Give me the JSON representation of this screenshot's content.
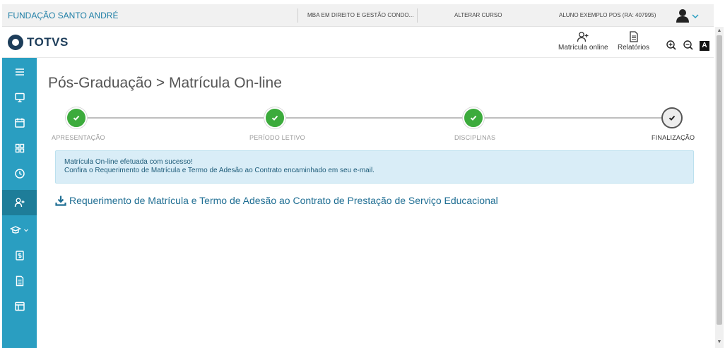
{
  "topbar": {
    "institution": "FUNDAÇÃO SANTO ANDRÉ",
    "course": "MBA EM DIREITO E GESTÃO CONDO...",
    "change_course": "ALTERAR CURSO",
    "student": "ALUNO EXEMPLO POS (RA: 407995)"
  },
  "header": {
    "logo_text": "TOTVS",
    "enroll_label": "Matrícula online",
    "reports_label": "Relatórios",
    "contrast_label": "A"
  },
  "sidebar": {
    "items": [
      {
        "icon": "menu-icon"
      },
      {
        "icon": "monitor-icon"
      },
      {
        "icon": "calendar-icon"
      },
      {
        "icon": "grid-icon"
      },
      {
        "icon": "clock-icon"
      },
      {
        "icon": "add-user-icon",
        "active": true
      },
      {
        "icon": "graduation-cap-icon"
      },
      {
        "icon": "money-icon"
      },
      {
        "icon": "document-icon"
      },
      {
        "icon": "layout-icon"
      }
    ]
  },
  "page": {
    "title": "Pós-Graduação > Matrícula On-line"
  },
  "stepper": {
    "steps": [
      {
        "label": "APRESENTAÇÃO",
        "state": "done"
      },
      {
        "label": "PERÍODO LETIVO",
        "state": "done"
      },
      {
        "label": "DISCIPLINAS",
        "state": "done"
      },
      {
        "label": "FINALIZAÇÃO",
        "state": "current"
      }
    ]
  },
  "alert": {
    "line1": "Matrícula On-line efetuada com sucesso!",
    "line2": "Confira o Requerimento de Matrícula e Termo de Adesão ao Contrato encaminhado em seu e-mail."
  },
  "download": {
    "label": "Requerimento de Matrícula e Termo de Adesão ao Contrato de Prestação de Serviço Educacional"
  },
  "colors": {
    "accent": "#2a9ec1",
    "accent_dark": "#1e7d99",
    "success": "#3cab3c",
    "alert_bg": "#d9edf7",
    "link": "#1f6e93"
  }
}
